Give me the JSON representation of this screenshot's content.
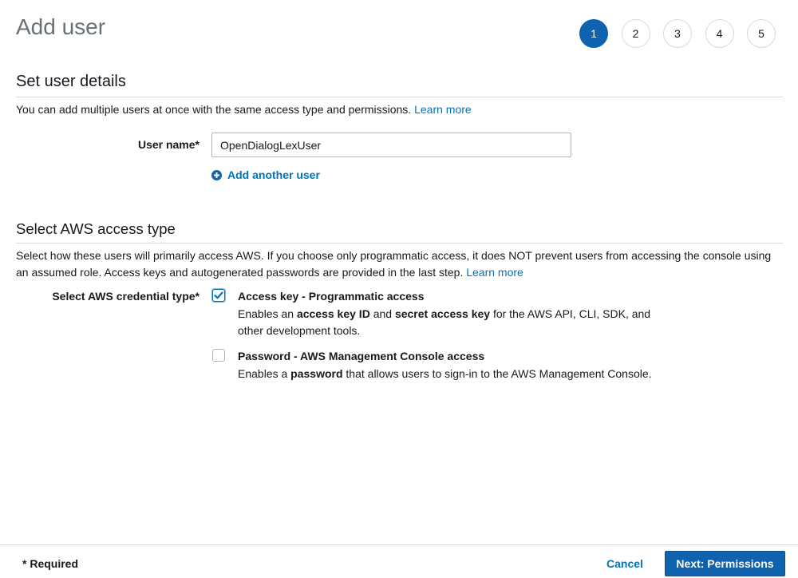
{
  "page": {
    "title": "Add user"
  },
  "steps": [
    "1",
    "2",
    "3",
    "4",
    "5"
  ],
  "active_step": 1,
  "details": {
    "heading": "Set user details",
    "description": "You can add multiple users at once with the same access type and permissions.",
    "learn_more": "Learn more",
    "username_label": "User name*",
    "username_value": "OpenDialogLexUser",
    "add_another": "Add another user"
  },
  "access": {
    "heading": "Select AWS access type",
    "description": "Select how these users will primarily access AWS. If you choose only programmatic access, it does NOT prevent users from accessing the console using an assumed role. Access keys and autogenerated passwords are provided in the last step.",
    "learn_more": "Learn more",
    "credential_label": "Select AWS credential type*",
    "options": [
      {
        "title": "Access key - Programmatic access",
        "checked": true,
        "desc_pre": "Enables an ",
        "desc_b1": "access key ID",
        "desc_mid": " and ",
        "desc_b2": "secret access key",
        "desc_post": " for the AWS API, CLI, SDK, and other development tools."
      },
      {
        "title": "Password - AWS Management Console access",
        "checked": false,
        "desc_pre": "Enables a ",
        "desc_b1": "password",
        "desc_post": " that allows users to sign-in to the AWS Management Console."
      }
    ]
  },
  "footer": {
    "required": "* Required",
    "cancel": "Cancel",
    "next": "Next: Permissions"
  },
  "colors": {
    "primary": "#0f62ad",
    "link": "#0073bb",
    "border": "#d5dbdb"
  }
}
